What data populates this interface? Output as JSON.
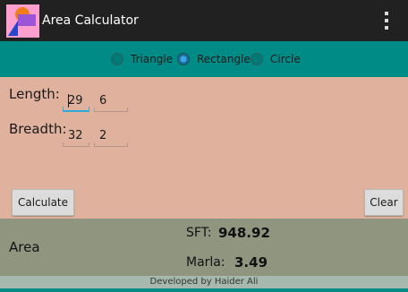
{
  "app": {
    "title": "Area Calculator"
  },
  "colors": {
    "actionbar": "#212121",
    "radio_bar": "#008b87",
    "input_panel": "#e0b19d",
    "result_panel": "#8f957f",
    "footer": "#a7b8af",
    "focus": "#34a8d8"
  },
  "shapes": {
    "options": [
      "Triangle",
      "Rectangle",
      "Circle"
    ],
    "selected": "Rectangle"
  },
  "inputs": {
    "length": {
      "label": "Length:",
      "feet": "29",
      "inches": "6"
    },
    "breadth": {
      "label": "Breadth:",
      "feet": "32",
      "inches": "2"
    }
  },
  "buttons": {
    "calculate": "Calculate",
    "clear": "Clear"
  },
  "results": {
    "area_label": "Area",
    "sft_label": "SFT:",
    "sft_value": "948.92",
    "marla_label": "Marla:",
    "marla_value": "3.49"
  },
  "footer": {
    "text": "Developed by Haider Ali"
  },
  "icons": {
    "app": "shapes-app-icon",
    "menu": "overflow-menu-icon"
  }
}
